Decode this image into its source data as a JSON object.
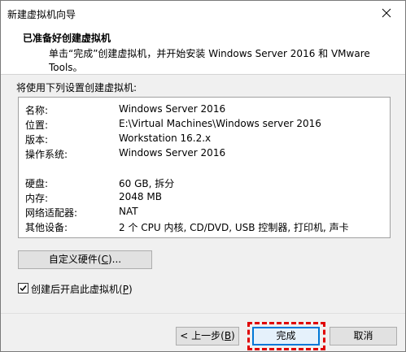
{
  "window": {
    "title": "新建虚拟机向导"
  },
  "header": {
    "title": "已准备好创建虚拟机",
    "description": "单击“完成”创建虚拟机，并开始安装 Windows Server 2016 和 VMware Tools。"
  },
  "summary": {
    "label": "将使用下列设置创建虚拟机:",
    "rows": [
      {
        "key": "名称:",
        "value": "Windows Server 2016"
      },
      {
        "key": "位置:",
        "value": "E:\\Virtual Machines\\Windows server 2016"
      },
      {
        "key": "版本:",
        "value": "Workstation 16.2.x"
      },
      {
        "key": "操作系统:",
        "value": "Windows Server 2016"
      },
      {
        "key": "",
        "value": ""
      },
      {
        "key": "硬盘:",
        "value": "60 GB, 拆分"
      },
      {
        "key": "内存:",
        "value": "2048 MB"
      },
      {
        "key": "网络适配器:",
        "value": "NAT"
      },
      {
        "key": "其他设备:",
        "value": "2 个 CPU 内核, CD/DVD, USB 控制器, 打印机, 声卡"
      }
    ]
  },
  "buttons": {
    "customize_text": "自定义硬件(",
    "customize_key": "C",
    "customize_suffix": ")...",
    "back_text": "< 上一步(",
    "back_key": "B",
    "back_suffix": ")",
    "finish": "完成",
    "cancel": "取消"
  },
  "checkbox": {
    "label_text": "创建后开启此虚拟机(",
    "label_key": "P",
    "label_suffix": ")",
    "checked": true
  },
  "icons": {
    "close": "close-icon",
    "check": "checkmark-icon"
  },
  "colors": {
    "highlight": "#e00000",
    "focus": "#0078d7"
  }
}
